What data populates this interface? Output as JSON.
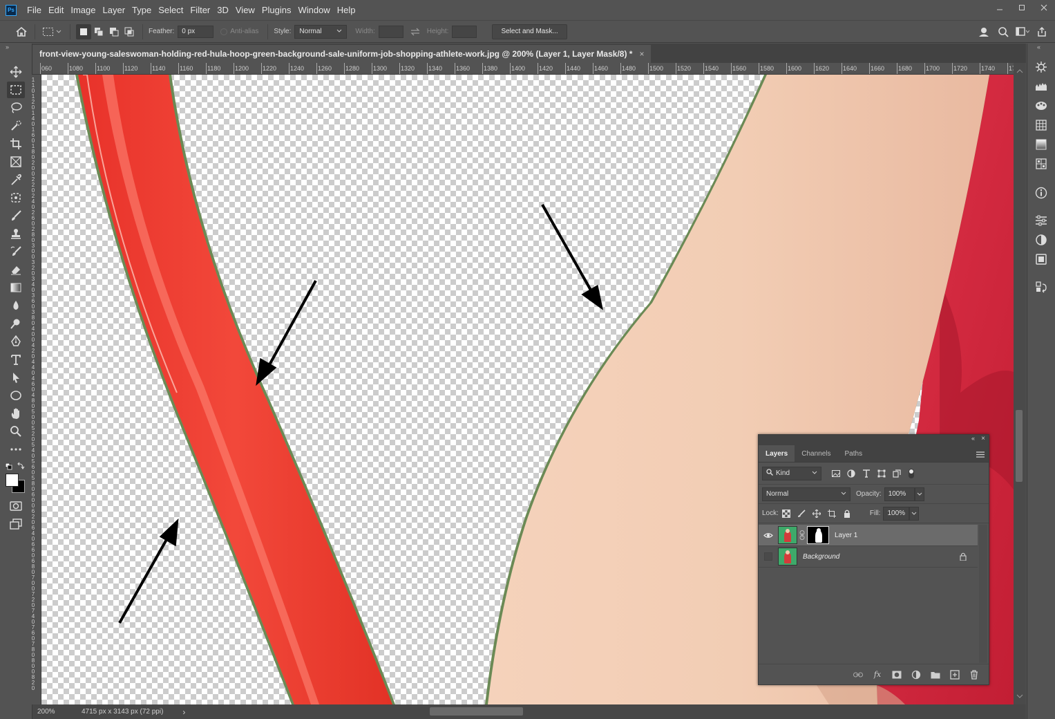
{
  "app": {
    "logo": "Ps"
  },
  "menu": [
    "File",
    "Edit",
    "Image",
    "Layer",
    "Type",
    "Select",
    "Filter",
    "3D",
    "View",
    "Plugins",
    "Window",
    "Help"
  ],
  "window_controls": [
    "minimize-icon",
    "maximize-icon",
    "close-icon"
  ],
  "options": {
    "feather_label": "Feather:",
    "feather_value": "0 px",
    "antialias_label": "Anti-alias",
    "style_label": "Style:",
    "style_value": "Normal",
    "width_label": "Width:",
    "height_label": "Height:",
    "select_and_mask": "Select and Mask..."
  },
  "document": {
    "tab_title": "front-view-young-saleswoman-holding-red-hula-hoop-green-background-sale-uniform-job-shopping-athlete-work.jpg @ 200% (Layer 1, Layer Mask/8) *",
    "close": "×"
  },
  "ruler": {
    "h_labels": [
      "060",
      "1080",
      "1100",
      "1120",
      "1140",
      "1160",
      "1180",
      "1200",
      "1220",
      "1240",
      "1260",
      "1280",
      "1300",
      "1320",
      "1340",
      "1360",
      "1380",
      "1400",
      "1420",
      "1440",
      "1460",
      "1480",
      "1500",
      "1520",
      "1540",
      "1560",
      "1580",
      "1600",
      "1620",
      "1640",
      "1660",
      "1680",
      "1700",
      "1720",
      "1740",
      "176"
    ],
    "v_labels": [
      "1",
      "1",
      "0",
      "1",
      "2",
      "0",
      "1",
      "4",
      "0",
      "1",
      "6",
      "0",
      "1",
      "8",
      "0",
      "2",
      "0",
      "0",
      "2",
      "2",
      "0",
      "2",
      "4",
      "0",
      "2",
      "6",
      "0",
      "2",
      "8",
      "0",
      "3",
      "0",
      "0",
      "3",
      "2",
      "0",
      "3",
      "4",
      "0",
      "3",
      "6",
      "0",
      "3",
      "8",
      "0",
      "4",
      "0",
      "0",
      "4",
      "2",
      "0",
      "4",
      "4",
      "0",
      "4",
      "6",
      "0",
      "4",
      "8",
      "0",
      "5",
      "0",
      "0",
      "5",
      "2",
      "0",
      "5",
      "4",
      "0",
      "5",
      "6",
      "0",
      "5",
      "8",
      "0",
      "6",
      "0",
      "0",
      "6",
      "2",
      "0",
      "6",
      "4",
      "0",
      "6",
      "6",
      "0",
      "6",
      "8",
      "0",
      "7",
      "0",
      "0",
      "7",
      "2",
      "0",
      "7",
      "4",
      "0",
      "7",
      "6",
      "0",
      "7",
      "8",
      "0",
      "8",
      "0",
      "0",
      "8",
      "2",
      "0"
    ]
  },
  "status": {
    "zoom": "200%",
    "doc_info": "4715 px x 3143 px (72 ppi)",
    "arrow": "›"
  },
  "layers_panel": {
    "tabs": [
      "Layers",
      "Channels",
      "Paths"
    ],
    "filter_kind": "Kind",
    "blend_mode": "Normal",
    "opacity_label": "Opacity:",
    "opacity_value": "100%",
    "lock_label": "Lock:",
    "fill_label": "Fill:",
    "fill_value": "100%",
    "layers": [
      {
        "name": "Layer 1",
        "visible": true,
        "selected": true,
        "has_mask": true
      },
      {
        "name": "Background",
        "visible": false,
        "selected": false,
        "locked": true
      }
    ],
    "bottom_icons": [
      "link-icon",
      "fx-icon",
      "mask-icon",
      "adjustment-icon",
      "folder-icon",
      "new-layer-icon",
      "trash-icon"
    ],
    "fx_label": "fx"
  },
  "colors": {
    "hoop_red": "#ee3a2c",
    "skin": "#f3cdb2",
    "shirt": "#d8283f",
    "fringe_green": "#6b8a55"
  }
}
